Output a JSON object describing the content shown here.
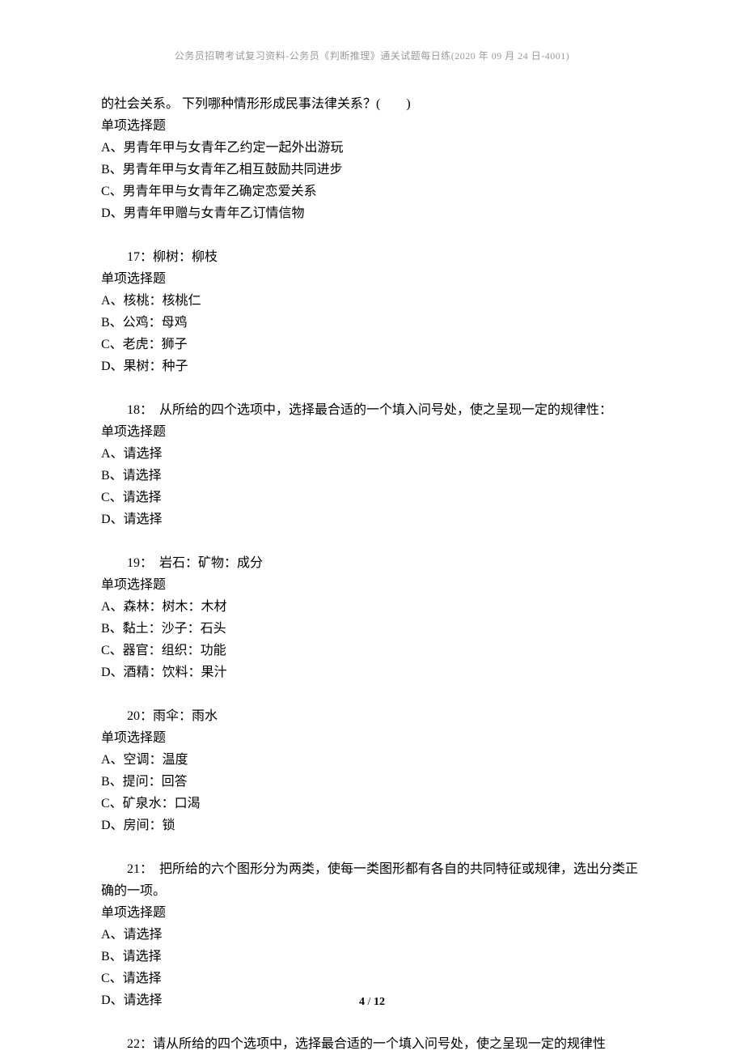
{
  "header": "公务员招聘考试复习资料-公务员《判断推理》通关试题每日练(2020 年 09 月 24 日-4001)",
  "q16": {
    "cont": "的社会关系。 下列哪种情形形成民事法律关系？(　　)",
    "type": "单项选择题",
    "a": "A、男青年甲与女青年乙约定一起外出游玩",
    "b": "B、男青年甲与女青年乙相互鼓励共同进步",
    "c": "C、男青年甲与女青年乙确定恋爱关系",
    "d": "D、男青年甲赠与女青年乙订情信物"
  },
  "q17": {
    "title": "　　17：柳树：柳枝",
    "type": "单项选择题",
    "a": "A、核桃：核桃仁",
    "b": "B、公鸡：母鸡",
    "c": "C、老虎：狮子",
    "d": "D、果树：种子"
  },
  "q18": {
    "title": "　　18：　从所给的四个选项中，选择最合适的一个填入问号处，使之呈现一定的规律性：",
    "type": "单项选择题",
    "a": "A、请选择",
    "b": "B、请选择",
    "c": "C、请选择",
    "d": "D、请选择"
  },
  "q19": {
    "title": "　　19：　岩石：矿物：成分",
    "type": "单项选择题",
    "a": "A、森林：树木：木材",
    "b": "B、黏土：沙子：石头",
    "c": "C、器官：组织：功能",
    "d": "D、酒精：饮料：果汁"
  },
  "q20": {
    "title": "　　20：雨伞：雨水",
    "type": "单项选择题",
    "a": "A、空调：温度",
    "b": "B、提问：回答",
    "c": "C、矿泉水：口渴",
    "d": "D、房间：锁"
  },
  "q21": {
    "title": "　　21：　把所给的六个图形分为两类，使每一类图形都有各自的共同特征或规律，选出分类正确的一项。",
    "type": "单项选择题",
    "a": "A、请选择",
    "b": "B、请选择",
    "c": "C、请选择",
    "d": "D、请选择"
  },
  "q22": {
    "title": "　　22：请从所给的四个选项中，选择最合适的一个填入问号处，使之呈现一定的规律性"
  },
  "footer": {
    "page": "4",
    "sep": " / ",
    "total": "12"
  }
}
